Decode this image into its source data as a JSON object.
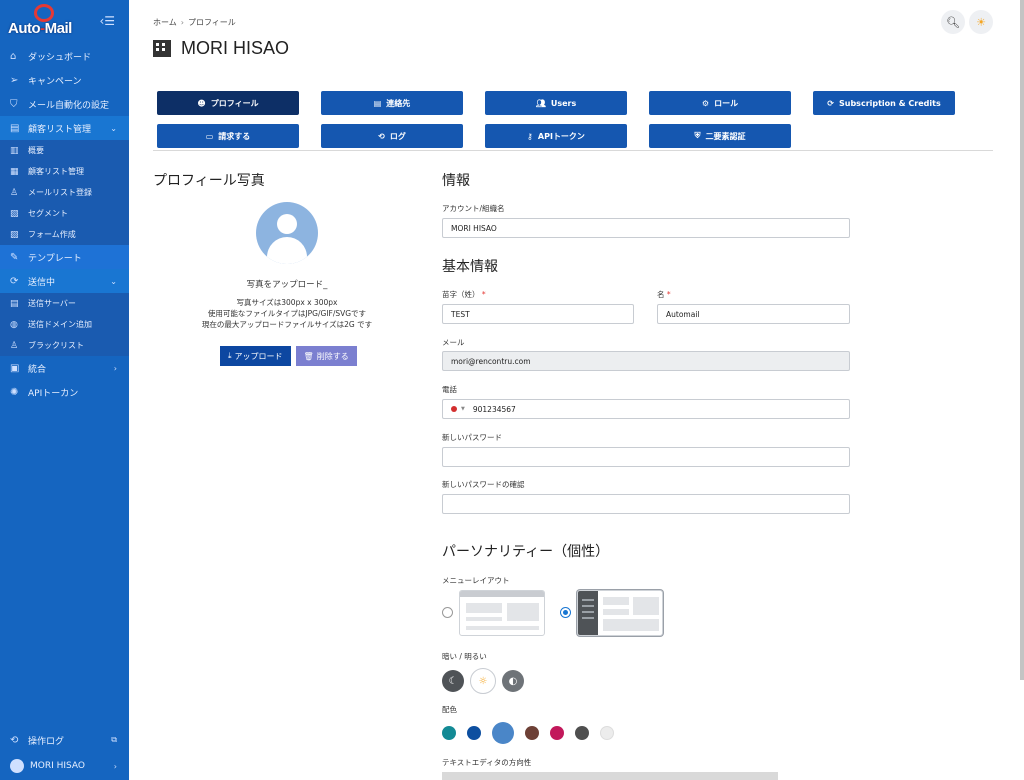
{
  "app": {
    "logo_text_1": "Auto",
    "logo_text_2": "Mail"
  },
  "sidebar": {
    "items": [
      {
        "label": "ダッシュボード",
        "icon": "home-icon"
      },
      {
        "label": "キャンペーン",
        "icon": "send-icon"
      },
      {
        "label": "メール自動化の設定",
        "icon": "shield-icon"
      },
      {
        "label": "顧客リスト管理",
        "icon": "list-icon"
      }
    ],
    "customer_sub": [
      {
        "label": "概要",
        "icon": "bar-chart-icon"
      },
      {
        "label": "顧客リスト管理",
        "icon": "table-icon"
      },
      {
        "label": "メールリスト登録",
        "icon": "user-add-icon"
      },
      {
        "label": "セグメント",
        "icon": "segment-icon"
      },
      {
        "label": "フォーム作成",
        "icon": "form-icon"
      }
    ],
    "items2": [
      {
        "label": "テンプレート",
        "icon": "edit-icon"
      },
      {
        "label": "送信中",
        "icon": "sync-icon"
      }
    ],
    "sending_sub": [
      {
        "label": "送信サーバー",
        "icon": "server-icon"
      },
      {
        "label": "送信ドメイン追加",
        "icon": "globe-icon"
      },
      {
        "label": "ブラックリスト",
        "icon": "user-block-icon"
      }
    ],
    "items3": [
      {
        "label": "統合",
        "icon": "integration-icon"
      },
      {
        "label": "APIトーカン",
        "icon": "api-icon"
      }
    ],
    "bottom": {
      "log_label": "操作ログ",
      "user_label": "MORI HISAO"
    }
  },
  "breadcrumb": {
    "home": "ホーム",
    "sep": "›",
    "current": "プロフィール"
  },
  "page_title": "MORI HISAO",
  "tabs": [
    {
      "label": "プロフィール",
      "icon": "smile-icon",
      "active": true
    },
    {
      "label": "連絡先",
      "icon": "contacts-icon",
      "active": false
    },
    {
      "label": "Users",
      "icon": "users-icon",
      "active": false
    },
    {
      "label": "ロール",
      "icon": "role-icon",
      "active": false
    },
    {
      "label": "Subscription & Credits",
      "icon": "refresh-icon",
      "active": false
    },
    {
      "label": "請求する",
      "icon": "card-icon",
      "active": false
    },
    {
      "label": "ログ",
      "icon": "history-icon",
      "active": false
    },
    {
      "label": "APIトークン",
      "icon": "key-icon",
      "active": false
    },
    {
      "label": "二要素認証",
      "icon": "shield-check-icon",
      "active": false
    }
  ],
  "photo": {
    "heading": "プロフィール写真",
    "upload_title": "写真をアップロード_",
    "desc_1": "写真サイズは300px x 300px",
    "desc_2": "使用可能なファイルタイプはJPG/GIF/SVGです",
    "desc_3": "現在の最大アップロードファイルサイズは2G です",
    "upload_button": "アップロード",
    "delete_button": "削除する"
  },
  "info": {
    "heading": "情報",
    "account_label": "アカウント/組織名",
    "account_value": "MORI HISAO"
  },
  "basic": {
    "heading": "基本情報",
    "last_name_label": "苗字（姓）",
    "last_name_value": "TEST",
    "first_name_label": "名",
    "first_name_value": "Automail",
    "required_mark": "*",
    "email_label": "メール",
    "email_value": "mori@rencontru.com",
    "phone_label": "電話",
    "phone_value": "901234567",
    "new_password_label": "新しいパスワード",
    "confirm_password_label": "新しいパスワードの確認"
  },
  "personality": {
    "heading": "パーソナリティー（個性）",
    "menu_layout_label": "メニューレイアウト",
    "layout_selected": "left",
    "dark_light_label": "暗い / 明るい",
    "color_label": "配色",
    "colors": [
      "#138a95",
      "#0d4fa0",
      "#4a86c8",
      "#6d4036",
      "#c2185b",
      "#4f4f4f",
      "#ececec"
    ],
    "selected_color": "#4a86c8",
    "editor_direction_label": "テキストエディタの方向性"
  }
}
